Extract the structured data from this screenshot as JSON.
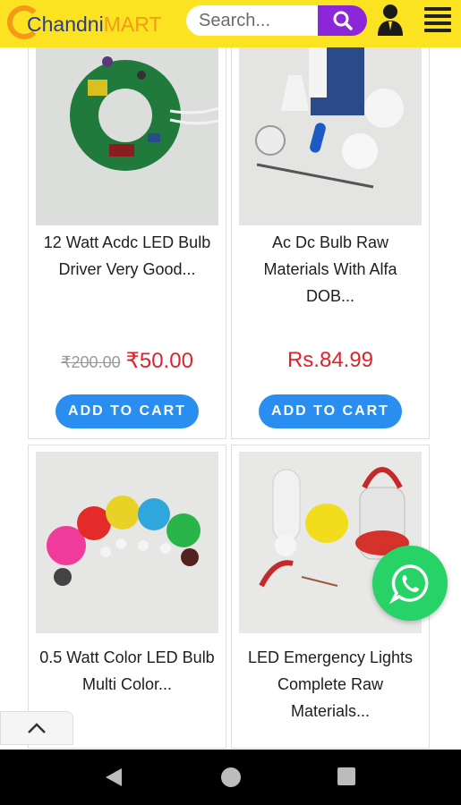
{
  "header": {
    "logo_part1": "Chandni",
    "logo_part2": "MART",
    "search_placeholder": "Search..."
  },
  "products": [
    {
      "title": "12 Watt Acdc LED Bulb Driver Very Good...",
      "old_price": "₹200.00",
      "price": "₹50.00",
      "cart_label": "ADD TO CART"
    },
    {
      "title": "Ac Dc Bulb Raw Materials With Alfa DOB...",
      "old_price": "",
      "price": "Rs.84.99",
      "cart_label": "ADD TO CART"
    },
    {
      "title": "0.5 Watt Color LED Bulb Multi Color...",
      "old_price": "",
      "price": "",
      "cart_label": ""
    },
    {
      "title": "LED Emergency Lights Complete Raw Materials...",
      "old_price": "",
      "price": "",
      "cart_label": ""
    }
  ],
  "colors": {
    "header_bg": "#fbe321",
    "search_button": "#8b27d8",
    "price_red": "#e0222a",
    "cart_button": "#2a8ef0",
    "whatsapp_green": "#27d366"
  },
  "icons": [
    "search-icon",
    "user-icon",
    "menu-icon",
    "whatsapp-icon",
    "chevron-up-icon",
    "back-icon",
    "home-icon",
    "recents-icon"
  ]
}
